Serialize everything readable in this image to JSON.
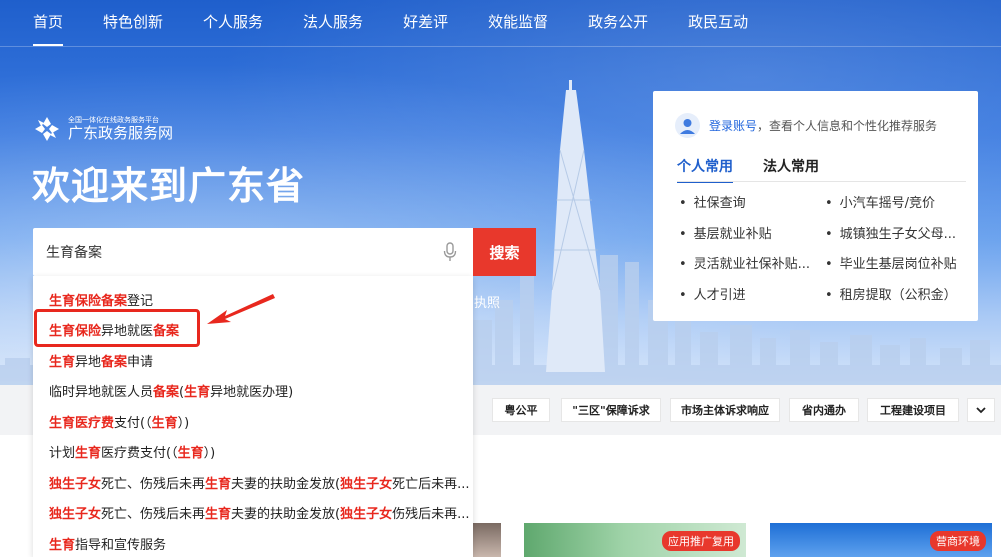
{
  "nav": {
    "items": [
      "首页",
      "特色创新",
      "个人服务",
      "法人服务",
      "好差评",
      "效能监督",
      "政务公开",
      "政民互动"
    ],
    "active_index": 0
  },
  "logo": {
    "small_text": "全国一体化在线政务服务平台",
    "main_text": "广东政务服务网"
  },
  "welcome": "欢迎来到广东省",
  "search": {
    "value": "生育备案",
    "button_label": "搜索",
    "peek_text": "执照"
  },
  "suggestions": [
    [
      {
        "t": "生育保险备案",
        "h": true
      },
      {
        "t": "登记",
        "h": false
      }
    ],
    [
      {
        "t": "生育保险",
        "h": true
      },
      {
        "t": "异地就医",
        "h": false
      },
      {
        "t": "备案",
        "h": true
      }
    ],
    [
      {
        "t": "生育",
        "h": true
      },
      {
        "t": "异地",
        "h": false
      },
      {
        "t": "备案",
        "h": true
      },
      {
        "t": "申请",
        "h": false
      }
    ],
    [
      {
        "t": "临时异地就医人员",
        "h": false
      },
      {
        "t": "备案",
        "h": true
      },
      {
        "t": "(",
        "h": false
      },
      {
        "t": "生育",
        "h": true
      },
      {
        "t": "异地就医办理)",
        "h": false
      }
    ],
    [
      {
        "t": "生育医疗费",
        "h": true
      },
      {
        "t": "支付(（",
        "h": false
      },
      {
        "t": "生育",
        "h": true
      },
      {
        "t": "）)",
        "h": false
      }
    ],
    [
      {
        "t": "计划",
        "h": false
      },
      {
        "t": "生育",
        "h": true
      },
      {
        "t": "医疗费支付(（",
        "h": false
      },
      {
        "t": "生育",
        "h": true
      },
      {
        "t": "）)",
        "h": false
      }
    ],
    [
      {
        "t": "独生子女",
        "h": true
      },
      {
        "t": "死亡、伤残后未再",
        "h": false
      },
      {
        "t": "生育",
        "h": true
      },
      {
        "t": "夫妻的扶助金发放(",
        "h": false
      },
      {
        "t": "独生子女",
        "h": true
      },
      {
        "t": "死亡后未再...",
        "h": false
      }
    ],
    [
      {
        "t": "独生子女",
        "h": true
      },
      {
        "t": "死亡、伤残后未再",
        "h": false
      },
      {
        "t": "生育",
        "h": true
      },
      {
        "t": "夫妻的扶助金发放(",
        "h": false
      },
      {
        "t": "独生子女",
        "h": true
      },
      {
        "t": "伤残后未再...",
        "h": false
      }
    ],
    [
      {
        "t": "生育",
        "h": true
      },
      {
        "t": "指导和宣传服务",
        "h": false
      }
    ]
  ],
  "card": {
    "login_link": "登录账号",
    "login_rest": "，查看个人信息和个性化推荐服务",
    "tabs": [
      "个人常用",
      "法人常用"
    ],
    "active_tab": 0,
    "services_left": [
      "社保查询",
      "基层就业补贴",
      "灵活就业社保补贴...",
      "人才引进"
    ],
    "services_right": [
      "小汽车摇号/竞价",
      "城镇独生子女父母...",
      "毕业生基层岗位补贴",
      "租房提取（公积金）"
    ]
  },
  "strip": {
    "chips": [
      "粤公平",
      "\"三区\"保障诉求",
      "市场主体诉求响应",
      "省内通办",
      "工程建设项目"
    ],
    "expand_icon": "chevron-down-icon"
  },
  "thumbs": {
    "badge_1": "应用推广复用",
    "badge_2": "营商环境"
  },
  "colors": {
    "accent_red": "#e8382c",
    "brand_blue": "#1f5fcc"
  }
}
